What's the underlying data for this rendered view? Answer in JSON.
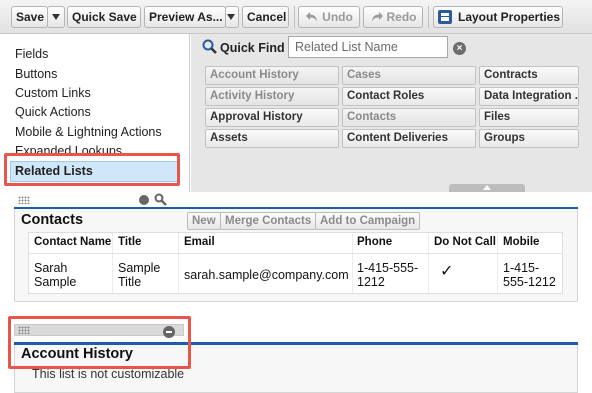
{
  "toolbar": {
    "save": "Save",
    "quick_save": "Quick Save",
    "preview_as": "Preview As...",
    "cancel": "Cancel",
    "undo": "Undo",
    "redo": "Redo",
    "layout_properties": "Layout Properties"
  },
  "palette": {
    "categories": [
      "Fields",
      "Buttons",
      "Custom Links",
      "Quick Actions",
      "Mobile & Lightning Actions",
      "Expanded Lookups",
      "Related Lists"
    ],
    "selected_category": "Related Lists",
    "quick_find": {
      "label": "Quick Find",
      "placeholder": "Related List Name",
      "clear": "×"
    },
    "items": [
      [
        "Account History",
        "Cases",
        "Contracts"
      ],
      [
        "Activity History",
        "Contact Roles",
        "Data Integration ..."
      ],
      [
        "Approval History",
        "Contacts",
        "Files"
      ],
      [
        "Assets",
        "Content Deliveries",
        "Groups"
      ]
    ],
    "used_items": [
      "Account History",
      "Activity History",
      "Cases",
      "Contacts"
    ]
  },
  "contacts_section": {
    "title": "Contacts",
    "buttons": [
      "New",
      "Merge Contacts",
      "Add to Campaign"
    ],
    "columns": [
      "Contact Name",
      "Title",
      "Email",
      "Phone",
      "Do Not Call",
      "Mobile"
    ],
    "row": {
      "name_1": "Sarah",
      "name_2": "Sample",
      "title_1": "Sample",
      "title_2": "Title",
      "email": "sarah.sample@company.com",
      "phone_1": "1-415-555-",
      "phone_2": "1212",
      "do_not_call": "✓",
      "mobile_1": "1-415-",
      "mobile_2": "555-1212"
    }
  },
  "account_history_section": {
    "title": "Account History",
    "note": "This list is not customizable"
  },
  "colors": {
    "accent_blue": "#1f5ca8",
    "highlight_red": "#e8554a",
    "selected_bg": "#cfe7f9"
  }
}
